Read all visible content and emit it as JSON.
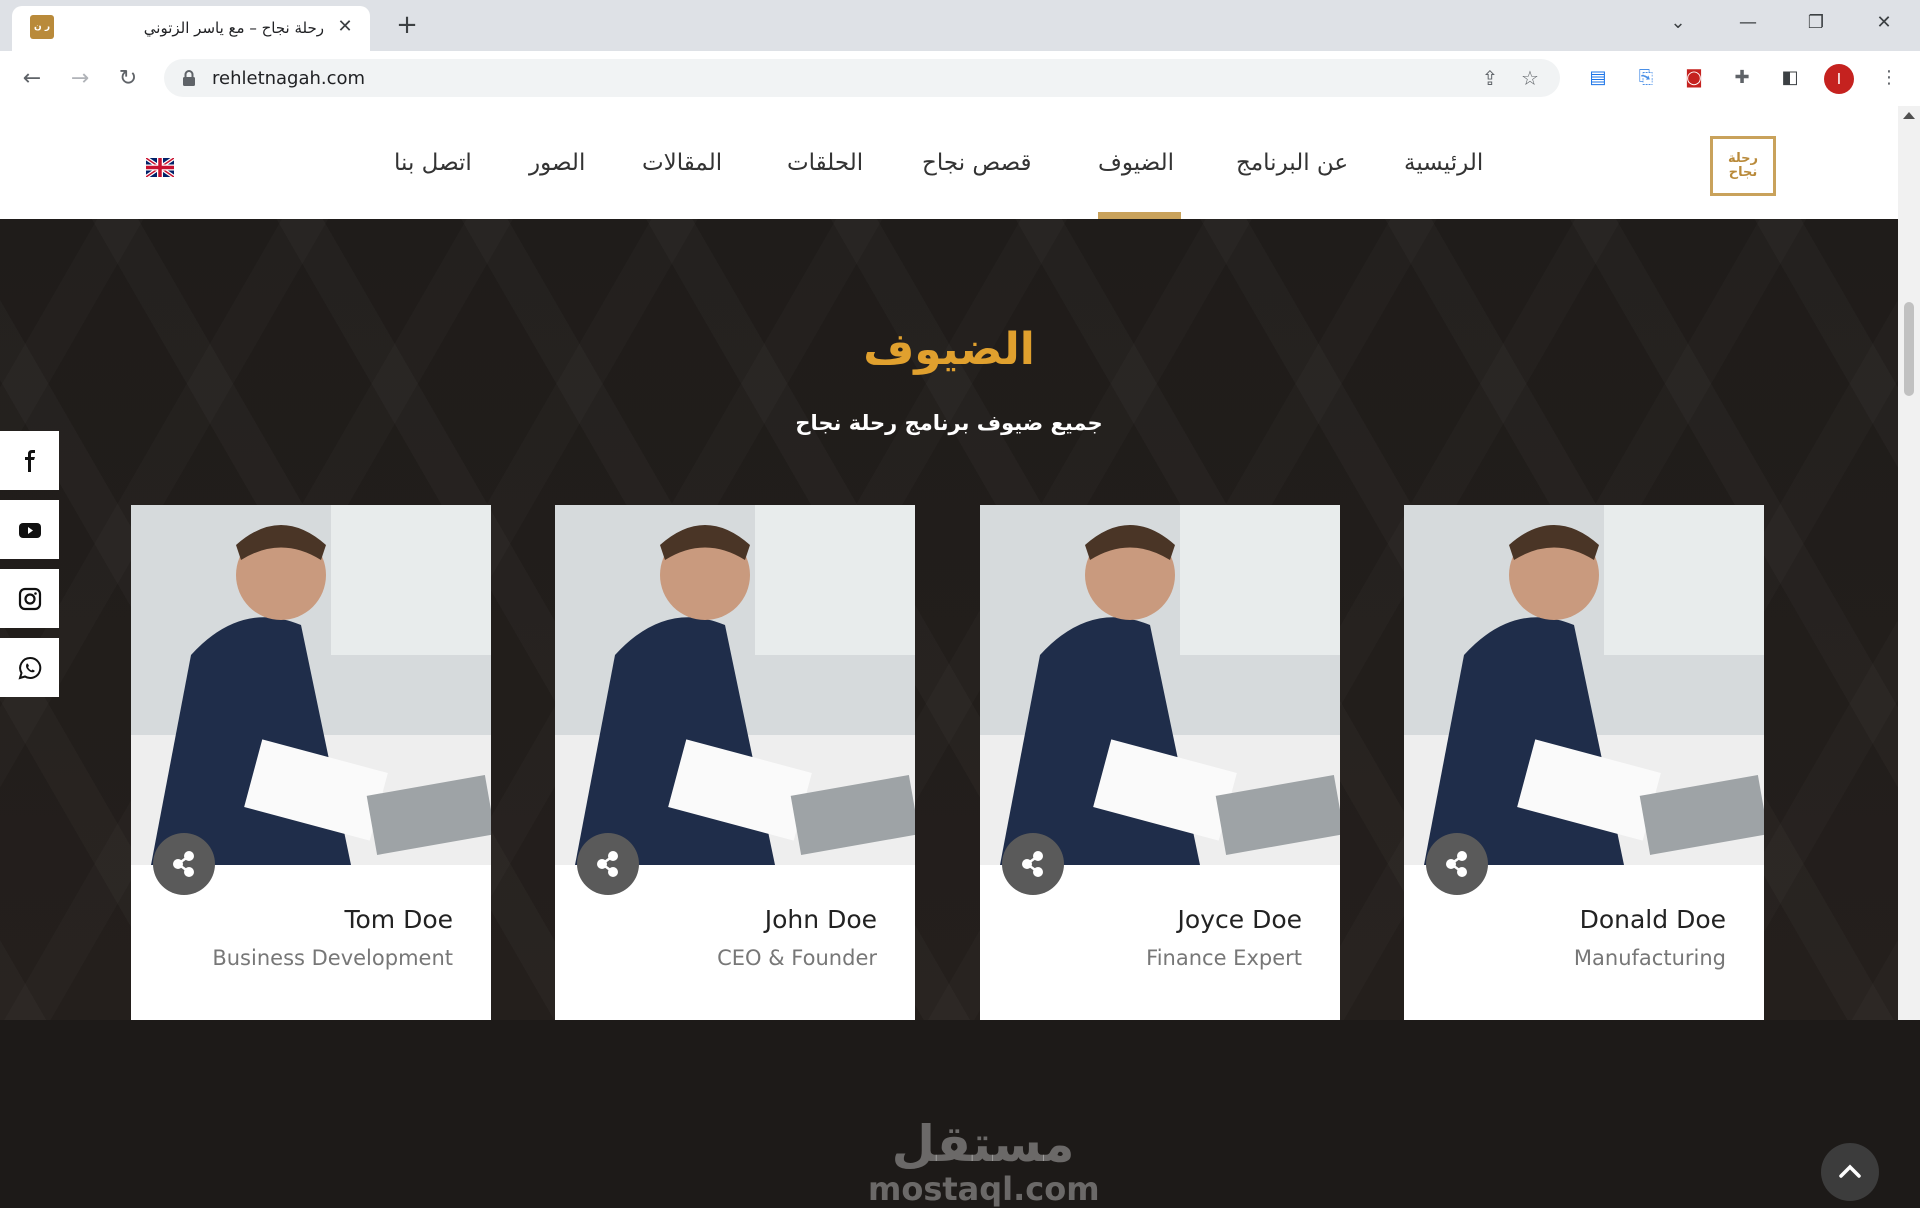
{
  "browser": {
    "tab_title": "رحلة نجاح – مع ياسر الزتوني",
    "url": "rehletnagah.com",
    "profile_initial": "I"
  },
  "site": {
    "logo_text": "رحلة نجاح",
    "nav": [
      {
        "label": "الرئيسية",
        "active": false
      },
      {
        "label": "عن البرنامج",
        "active": false
      },
      {
        "label": "الضيوف",
        "active": true
      },
      {
        "label": "قصص نجاح",
        "active": false
      },
      {
        "label": "الحلقات",
        "active": false
      },
      {
        "label": "المقالات",
        "active": false
      },
      {
        "label": "الصور",
        "active": false
      },
      {
        "label": "اتصل بنا",
        "active": false
      }
    ],
    "language_flag": "uk-flag-icon",
    "accent_color": "#c9a25b"
  },
  "section": {
    "title": "الضيوف",
    "subtitle": "جميع ضيوف برنامج رحلة نجاح",
    "title_color": "#e0a02e"
  },
  "guests": [
    {
      "name": "Tom Doe",
      "role": "Business Development"
    },
    {
      "name": "John Doe",
      "role": "CEO & Founder"
    },
    {
      "name": "Joyce Doe",
      "role": "Finance Expert"
    },
    {
      "name": "Donald Doe",
      "role": "Manufacturing"
    }
  ],
  "social": [
    "facebook-icon",
    "youtube-icon",
    "instagram-icon",
    "whatsapp-icon"
  ],
  "watermark": {
    "arabic": "مستقل",
    "latin": "mostaql.com"
  }
}
